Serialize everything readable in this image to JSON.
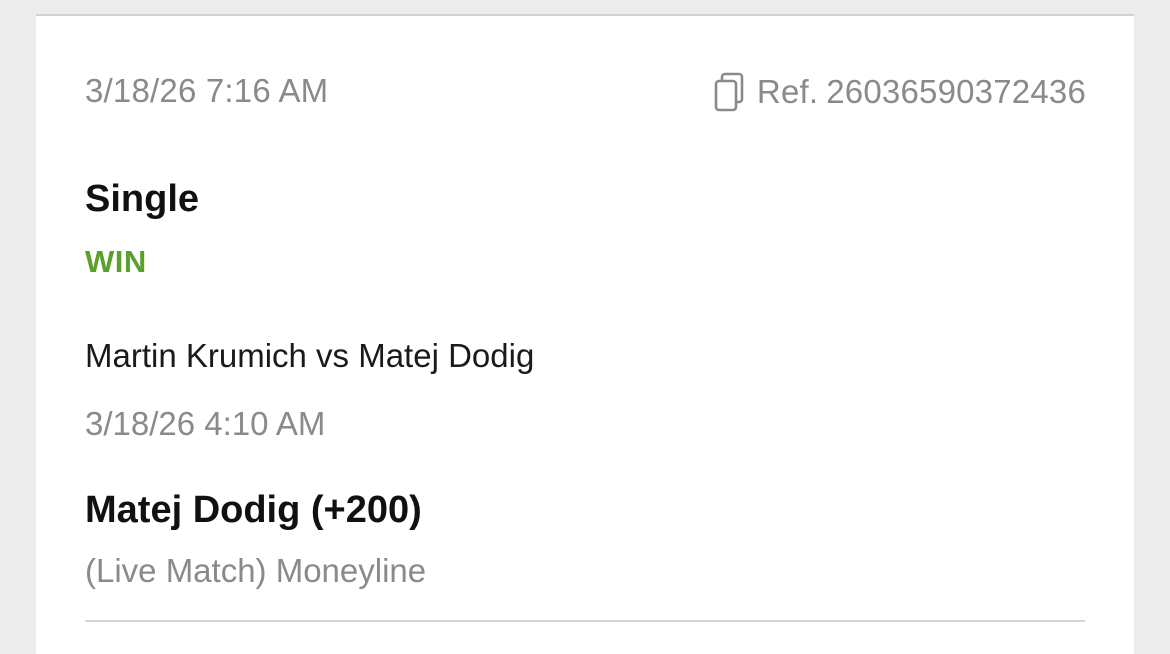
{
  "bet": {
    "placed_datetime": "3/18/26 7:16 AM",
    "ref_prefix": "Ref.",
    "ref_number": "26036590372436",
    "type": "Single",
    "status": "WIN",
    "event": "Martin Krumich vs Matej Dodig",
    "event_datetime": "3/18/26 4:10 AM",
    "selection": "Matej Dodig (+200)",
    "market": "(Live Match) Moneyline"
  },
  "icons": {
    "copy": "copy-icon"
  },
  "colors": {
    "status_win": "#5aa02c",
    "muted_text": "#8a8a8a",
    "primary_text": "#111111",
    "page_background": "#ececec",
    "card_background": "#ffffff"
  }
}
